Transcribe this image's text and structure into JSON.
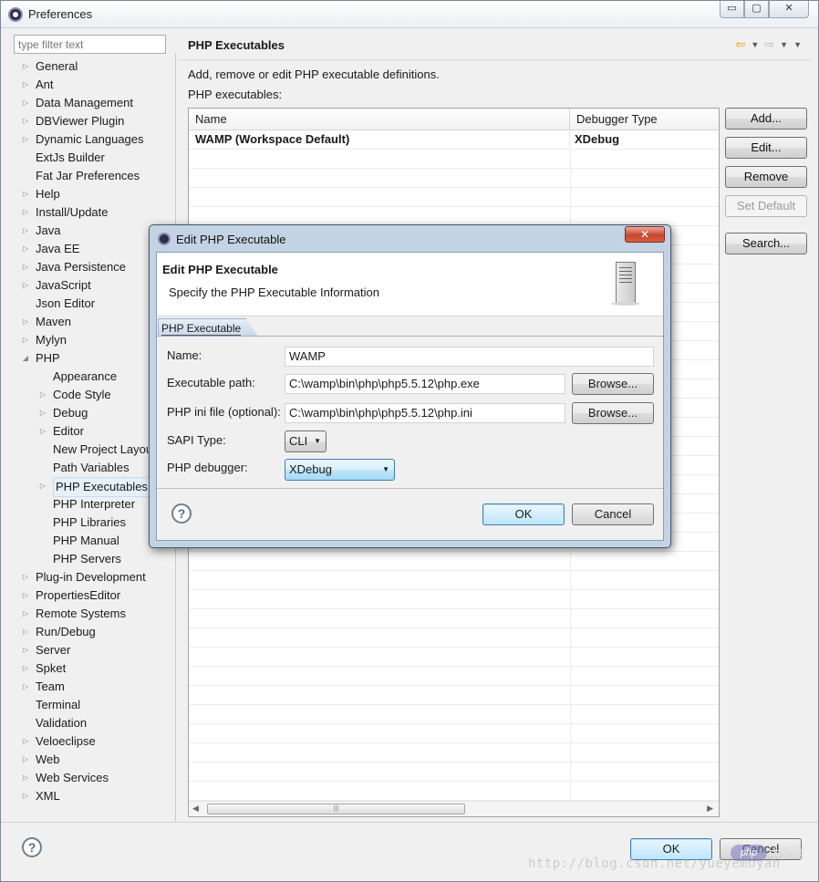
{
  "window": {
    "title": "Preferences",
    "controls": {
      "minimize": "▭",
      "maximize": "▢",
      "close": "✕"
    }
  },
  "filter": {
    "placeholder": "type filter text"
  },
  "tree": {
    "items": [
      {
        "label": "General",
        "expander": "collapsed",
        "level": 0
      },
      {
        "label": "Ant",
        "expander": "collapsed",
        "level": 0
      },
      {
        "label": "Data Management",
        "expander": "collapsed",
        "level": 0
      },
      {
        "label": "DBViewer Plugin",
        "expander": "collapsed",
        "level": 0
      },
      {
        "label": "Dynamic Languages",
        "expander": "collapsed",
        "level": 0
      },
      {
        "label": "ExtJs Builder",
        "expander": "none",
        "level": 0
      },
      {
        "label": "Fat Jar Preferences",
        "expander": "none",
        "level": 0
      },
      {
        "label": "Help",
        "expander": "collapsed",
        "level": 0
      },
      {
        "label": "Install/Update",
        "expander": "collapsed",
        "level": 0
      },
      {
        "label": "Java",
        "expander": "collapsed",
        "level": 0
      },
      {
        "label": "Java EE",
        "expander": "collapsed",
        "level": 0
      },
      {
        "label": "Java Persistence",
        "expander": "collapsed",
        "level": 0
      },
      {
        "label": "JavaScript",
        "expander": "collapsed",
        "level": 0
      },
      {
        "label": "Json Editor",
        "expander": "none",
        "level": 0
      },
      {
        "label": "Maven",
        "expander": "collapsed",
        "level": 0
      },
      {
        "label": "Mylyn",
        "expander": "collapsed",
        "level": 0
      },
      {
        "label": "PHP",
        "expander": "expanded",
        "level": 0
      },
      {
        "label": "Appearance",
        "expander": "none",
        "level": 1
      },
      {
        "label": "Code Style",
        "expander": "collapsed",
        "level": 1
      },
      {
        "label": "Debug",
        "expander": "collapsed",
        "level": 1
      },
      {
        "label": "Editor",
        "expander": "collapsed",
        "level": 1
      },
      {
        "label": "New Project Layou",
        "expander": "none",
        "level": 1
      },
      {
        "label": "Path Variables",
        "expander": "none",
        "level": 1
      },
      {
        "label": "PHP Executables",
        "expander": "collapsed",
        "level": 1,
        "selected": true
      },
      {
        "label": "PHP Interpreter",
        "expander": "none",
        "level": 1
      },
      {
        "label": "PHP Libraries",
        "expander": "none",
        "level": 1
      },
      {
        "label": "PHP Manual",
        "expander": "none",
        "level": 1
      },
      {
        "label": "PHP Servers",
        "expander": "none",
        "level": 1
      },
      {
        "label": "Plug-in Development",
        "expander": "collapsed",
        "level": 0
      },
      {
        "label": "PropertiesEditor",
        "expander": "collapsed",
        "level": 0
      },
      {
        "label": "Remote Systems",
        "expander": "collapsed",
        "level": 0
      },
      {
        "label": "Run/Debug",
        "expander": "collapsed",
        "level": 0
      },
      {
        "label": "Server",
        "expander": "collapsed",
        "level": 0
      },
      {
        "label": "Spket",
        "expander": "collapsed",
        "level": 0
      },
      {
        "label": "Team",
        "expander": "collapsed",
        "level": 0
      },
      {
        "label": "Terminal",
        "expander": "none",
        "level": 0
      },
      {
        "label": "Validation",
        "expander": "none",
        "level": 0
      },
      {
        "label": "Veloeclipse",
        "expander": "collapsed",
        "level": 0
      },
      {
        "label": "Web",
        "expander": "collapsed",
        "level": 0
      },
      {
        "label": "Web Services",
        "expander": "collapsed",
        "level": 0
      },
      {
        "label": "XML",
        "expander": "collapsed",
        "level": 0
      }
    ]
  },
  "page": {
    "title": "PHP Executables",
    "description": "Add, remove or edit PHP executable definitions.",
    "list_label": "PHP executables:",
    "nav": {
      "back": "⇦",
      "forward": "⇨",
      "dropdown": "▼",
      "menu": "▼"
    },
    "table": {
      "columns": [
        "Name",
        "Debugger Type"
      ],
      "rows": [
        {
          "name": "WAMP (Workspace Default)",
          "debugger": "XDebug"
        }
      ],
      "scroll_thumb": "|||"
    },
    "buttons": {
      "add": "Add...",
      "edit": "Edit...",
      "remove": "Remove",
      "set_default": "Set Default",
      "search": "Search..."
    }
  },
  "footer": {
    "help": "?",
    "ok": "OK",
    "cancel": "Cancel"
  },
  "dialog": {
    "title": "Edit PHP Executable",
    "close": "✕",
    "header_title": "Edit PHP Executable",
    "header_subtitle": "Specify the PHP Executable Information",
    "tab": "PHP Executable",
    "fields": {
      "name": {
        "label": "Name:",
        "value": "WAMP"
      },
      "exe_path": {
        "label": "Executable path:",
        "value": "C:\\wamp\\bin\\php\\php5.5.12\\php.exe"
      },
      "ini_file": {
        "label": "PHP ini file (optional):",
        "value": "C:\\wamp\\bin\\php\\php5.5.12\\php.ini"
      },
      "sapi": {
        "label": "SAPI Type:",
        "value": "CLI"
      },
      "debugger": {
        "label": "PHP debugger:",
        "value": "XDebug"
      }
    },
    "browse": "Browse...",
    "help": "?",
    "ok": "OK",
    "cancel": "Cancel"
  },
  "watermark": {
    "badge": "php",
    "cn": "中文网",
    "url": "http://blog.csdn.net/yueyemoyan"
  }
}
